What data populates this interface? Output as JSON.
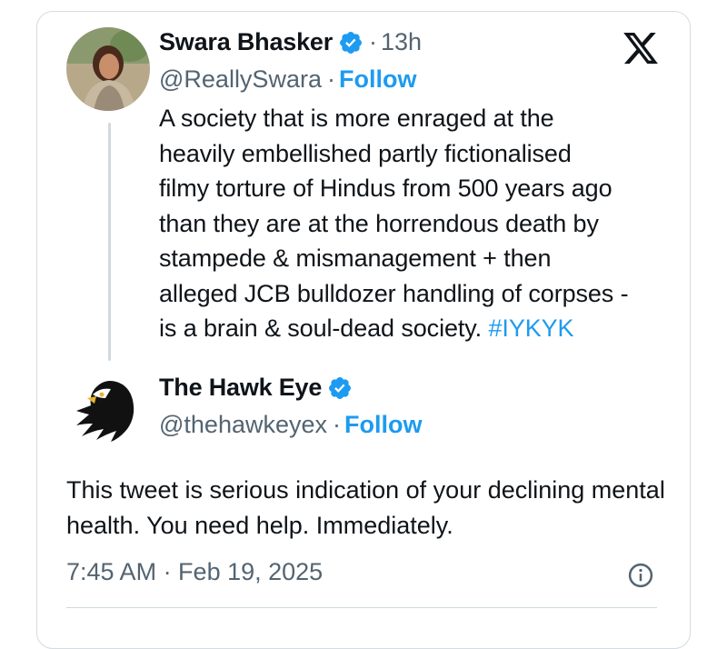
{
  "quoted_tweet": {
    "author_name": "Swara Bhasker",
    "time_ago": "13h",
    "handle": "@ReallySwara",
    "follow_label": "Follow",
    "text_lines": [
      "A society that is more enraged at the",
      "heavily embellished partly fictionalised",
      "filmy torture of Hindus from 500 years ago",
      "than they are at the horrendous death by",
      "stampede & mismanagement + then",
      "alleged JCB bulldozer handling of corpses -",
      "is a brain & soul-dead society. "
    ],
    "hashtag": "#IYKYK"
  },
  "reply_tweet": {
    "author_name": "The Hawk Eye",
    "handle": "@thehawkeyex",
    "follow_label": "Follow",
    "text": "This tweet is serious indication of your declining mental health. You need help. Immediately.",
    "timestamp": "7:45 AM · Feb 19, 2025"
  },
  "separator": "·",
  "colors": {
    "accent": "#1d9bf0",
    "text": "#0f1419",
    "secondary": "#536471",
    "border": "#cfd9de"
  },
  "icons": {
    "platform_logo": "x-logo-icon",
    "verified": "verified-badge-icon",
    "info": "info-icon"
  }
}
